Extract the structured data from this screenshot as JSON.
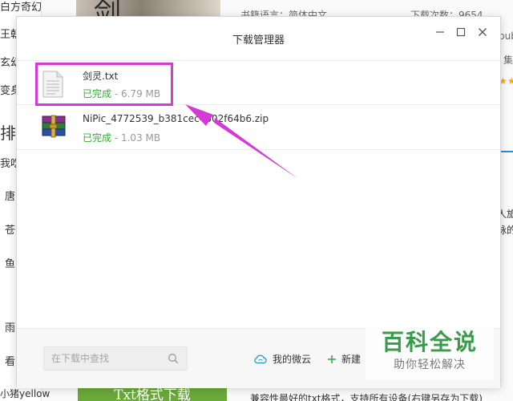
{
  "background": {
    "left_column": [
      "白方奇幻",
      "王朝",
      "玄幻",
      "变身",
      "排",
      "我吃",
      "唐",
      "苍",
      "鱼",
      "雨",
      "看",
      "小猪yellow"
    ],
    "info_language": "书籍语言：简体中文",
    "info_downloads": "下载次数：9654",
    "info_right_top": "pub",
    "info_right_collection": "集",
    "info_right_text": [
      "人旅",
      "脉的"
    ],
    "bottom_button": "Txt格式下载",
    "bottom_text": "兼容性最好的txt格式，支持所有设备(右键另存为下载)"
  },
  "dialog": {
    "title": "下载管理器",
    "files": [
      {
        "name": "剑灵.txt",
        "status": "已完成",
        "size": "6.79 MB",
        "icon": "text-file-icon"
      },
      {
        "name": "NiPic_4772539_b381cec4802f64b6.zip",
        "status": "已完成",
        "size": "1.03 MB",
        "icon": "winrar-archive-icon"
      }
    ],
    "search_placeholder": "在下载中查找",
    "weiyun_label": "我的微云",
    "new_label": "新建"
  },
  "annotation_color": "#d63ad6",
  "watermark": {
    "main": "百科全说",
    "sub": "助你轻松解决"
  }
}
